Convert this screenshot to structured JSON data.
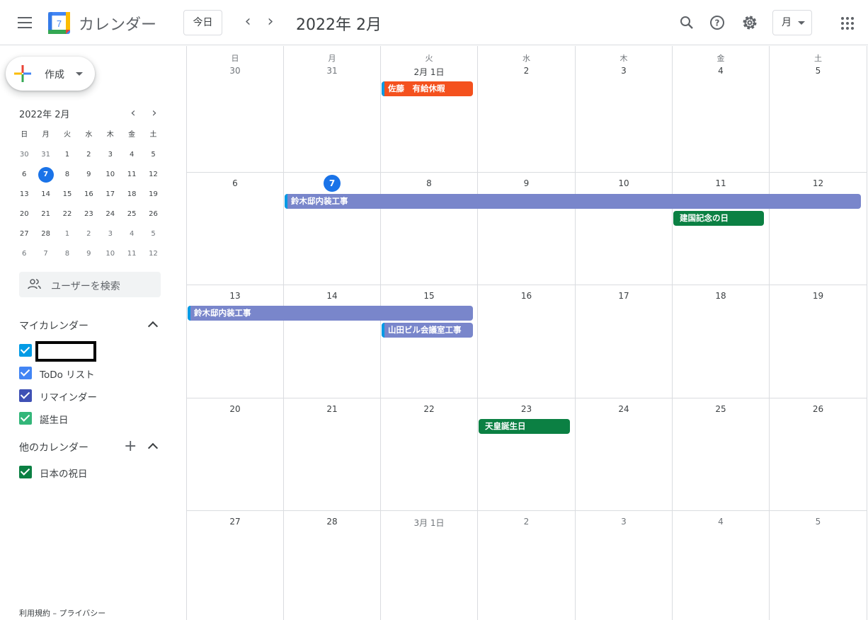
{
  "header": {
    "app_title": "カレンダー",
    "logo_day": "7",
    "today_label": "今日",
    "prev": "‹",
    "next": "›",
    "current_month": "2022年 2月",
    "view_label": "月"
  },
  "sidebar": {
    "create_label": "作成",
    "mini_cal": {
      "title": "2022年 2月",
      "prev": "‹",
      "next": "›",
      "weekdays": [
        "日",
        "月",
        "火",
        "水",
        "木",
        "金",
        "土"
      ],
      "weeks": [
        [
          "30",
          "31",
          "1",
          "2",
          "3",
          "4",
          "5"
        ],
        [
          "6",
          "7",
          "8",
          "9",
          "10",
          "11",
          "12"
        ],
        [
          "13",
          "14",
          "15",
          "16",
          "17",
          "18",
          "19"
        ],
        [
          "20",
          "21",
          "22",
          "23",
          "24",
          "25",
          "26"
        ],
        [
          "27",
          "28",
          "1",
          "2",
          "3",
          "4",
          "5"
        ],
        [
          "6",
          "7",
          "8",
          "9",
          "10",
          "11",
          "12"
        ]
      ]
    },
    "search_people": "ユーザーを検索",
    "my_calendars_title": "マイカレンダー",
    "my_calendars": [
      {
        "name": "",
        "color": "#039be5"
      },
      {
        "name": "ToDo リスト",
        "color": "#4285f4"
      },
      {
        "name": "リマインダー",
        "color": "#3f51b5"
      },
      {
        "name": "誕生日",
        "color": "#33b679"
      }
    ],
    "other_calendars_title": "他のカレンダー",
    "other_calendars": [
      {
        "name": "日本の祝日",
        "color": "#0b8043"
      }
    ],
    "footer": "利用規約 – プライバシー"
  },
  "month": {
    "weekdays": [
      "日",
      "月",
      "火",
      "水",
      "木",
      "金",
      "土"
    ],
    "weeks": [
      [
        "30",
        "31",
        "2月 1日",
        "2",
        "3",
        "4",
        "5"
      ],
      [
        "6",
        "7",
        "8",
        "9",
        "10",
        "11",
        "12"
      ],
      [
        "13",
        "14",
        "15",
        "16",
        "17",
        "18",
        "19"
      ],
      [
        "20",
        "21",
        "22",
        "23",
        "24",
        "25",
        "26"
      ],
      [
        "27",
        "28",
        "3月 1日",
        "2",
        "3",
        "4",
        "5"
      ]
    ],
    "events": [
      {
        "title": "佐藤　有給休暇",
        "color": "#f4511e"
      },
      {
        "title": "鈴木邸内装工事",
        "color": "#7986cb"
      },
      {
        "title": "建国記念の日",
        "color": "#0b8043"
      },
      {
        "title": "鈴木邸内装工事",
        "color": "#7986cb"
      },
      {
        "title": "山田ビル会議室工事",
        "color": "#7986cb"
      },
      {
        "title": "天皇誕生日",
        "color": "#0b8043"
      }
    ]
  }
}
